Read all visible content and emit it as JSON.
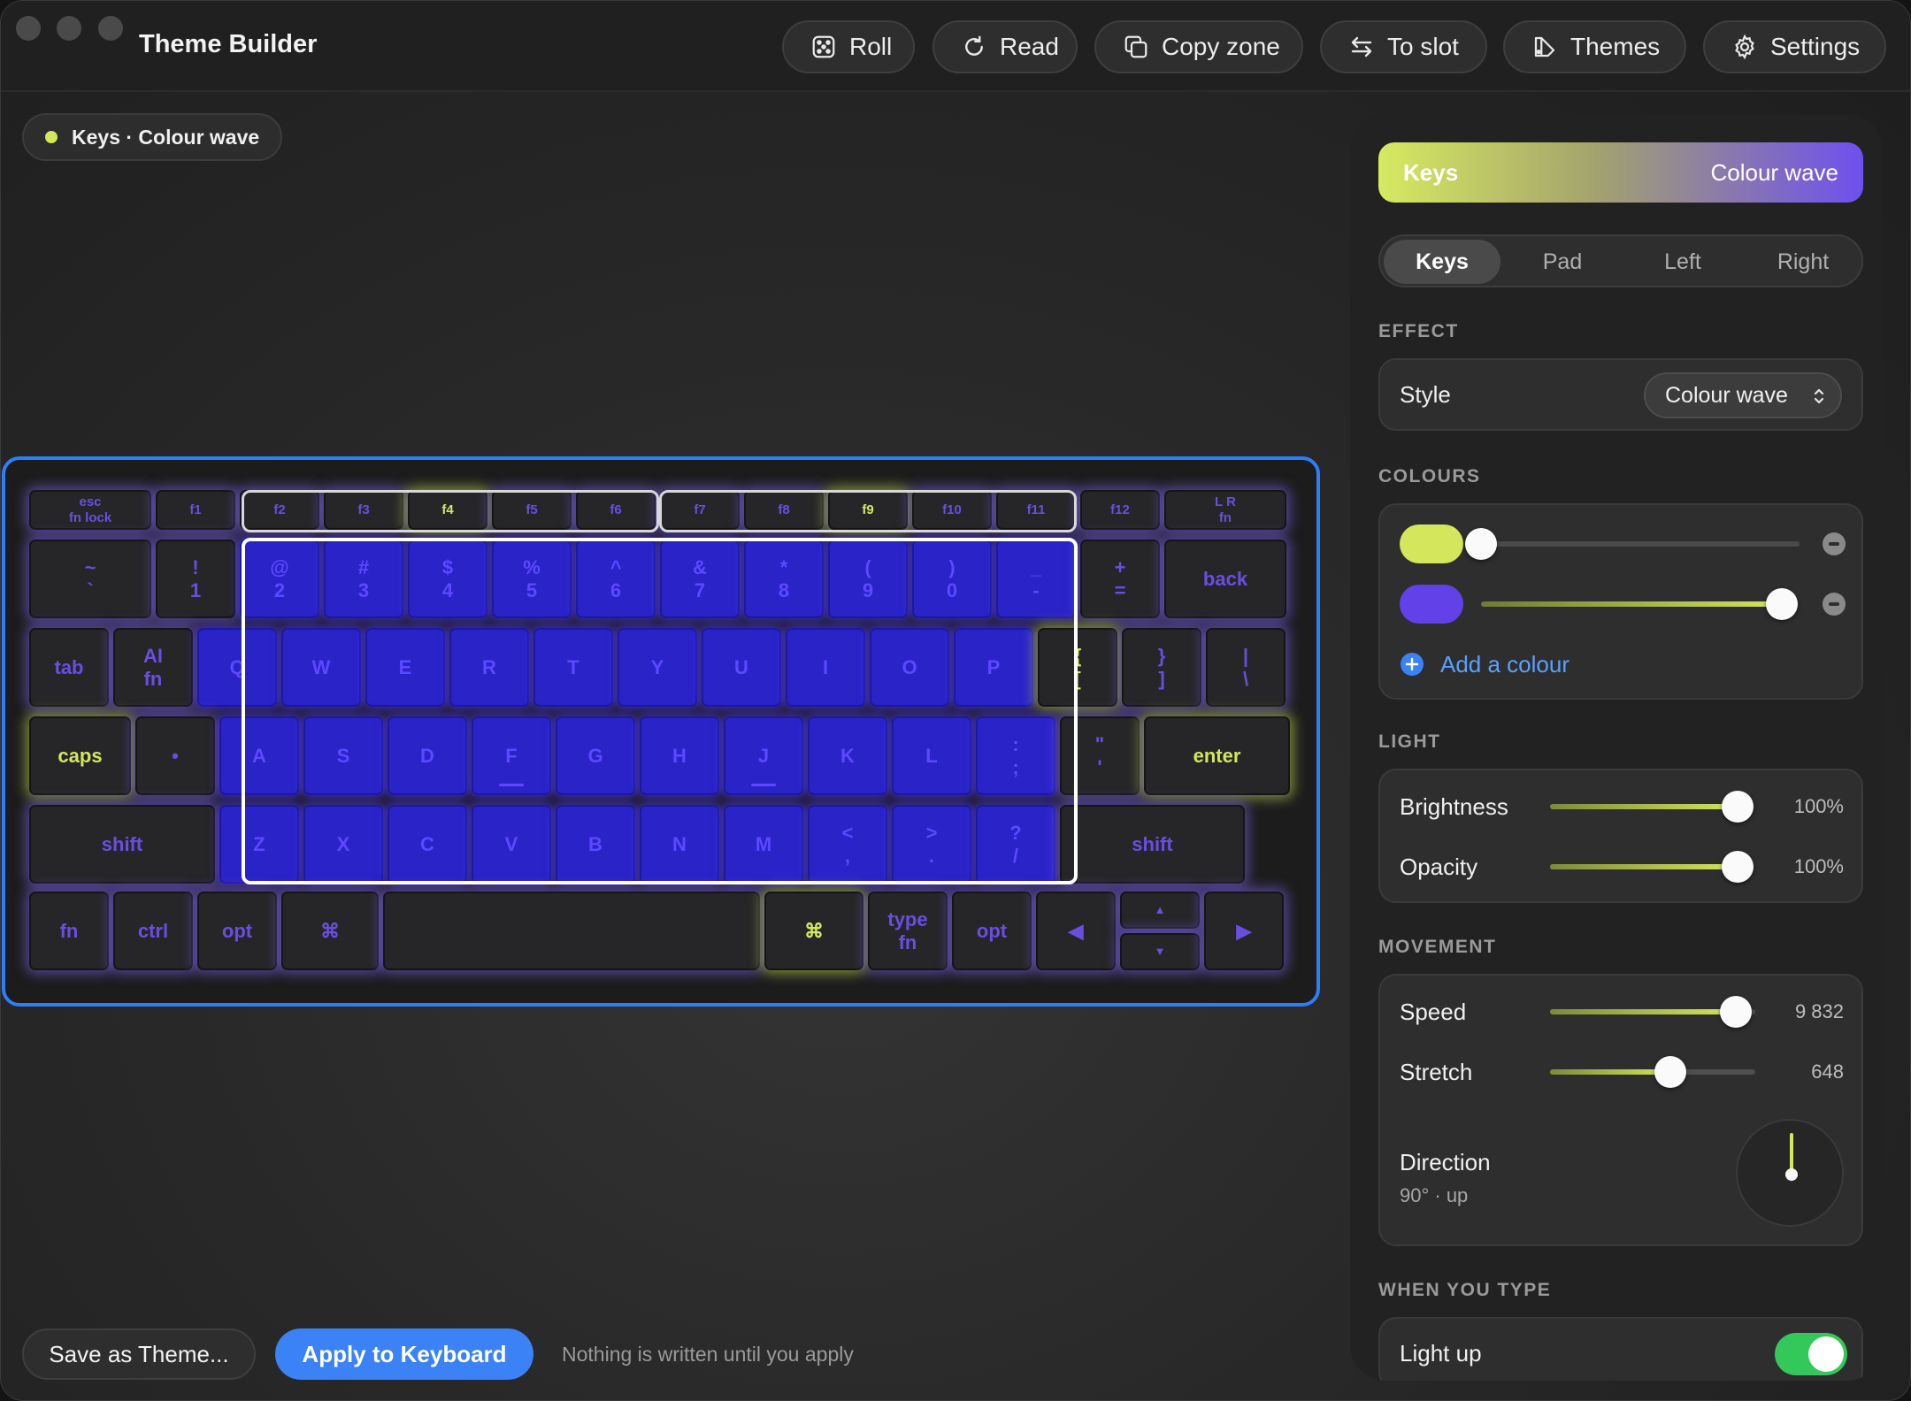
{
  "app": {
    "title": "Theme Builder"
  },
  "toolbar": {
    "roll": "Roll",
    "read": "Read",
    "copy_zone": "Copy zone",
    "to_slot": "To slot",
    "themes": "Themes",
    "settings": "Settings"
  },
  "zone_chip": {
    "label": "Keys · Colour wave"
  },
  "keyboard": {
    "rows": [
      [
        [
          "esc\nfn lock",
          "b"
        ],
        [
          "f1",
          "b"
        ],
        [
          "f2",
          "b"
        ],
        [
          "f3",
          "b"
        ],
        [
          "f4",
          "g"
        ],
        [
          "f5",
          "b"
        ],
        [
          "f6",
          "b"
        ],
        [
          "f7",
          "b"
        ],
        [
          "f8",
          "b"
        ],
        [
          "f9",
          "g"
        ],
        [
          "f10",
          "b"
        ],
        [
          "f11",
          "b"
        ],
        [
          "f12",
          "b"
        ],
        [
          "L R\nfn",
          "b"
        ]
      ],
      [
        [
          "~\n`",
          "b"
        ],
        [
          "!\n1",
          "b"
        ],
        [
          "@\n2",
          "l"
        ],
        [
          "#\n3",
          "l"
        ],
        [
          "$\n4",
          "l"
        ],
        [
          "%\n5",
          "l"
        ],
        [
          "^\n6",
          "l"
        ],
        [
          "&\n7",
          "l"
        ],
        [
          "*\n8",
          "l"
        ],
        [
          "(\n9",
          "l"
        ],
        [
          ")\n0",
          "l"
        ],
        [
          "_\n-",
          "l"
        ],
        [
          "+\n=",
          "b"
        ],
        [
          "back",
          "b"
        ]
      ],
      [
        [
          "tab",
          "b"
        ],
        [
          "AI\nfn",
          "b"
        ],
        [
          "Q",
          "l"
        ],
        [
          "W",
          "l"
        ],
        [
          "E",
          "l"
        ],
        [
          "R",
          "l"
        ],
        [
          "T",
          "l"
        ],
        [
          "Y",
          "l"
        ],
        [
          "U",
          "l"
        ],
        [
          "I",
          "l"
        ],
        [
          "O",
          "l"
        ],
        [
          "P",
          "l"
        ],
        [
          "{\n[",
          "g"
        ],
        [
          "}\n]",
          "b"
        ],
        [
          "|\n\\",
          "b"
        ]
      ],
      [
        [
          "caps",
          "g"
        ],
        [
          "•",
          "b"
        ],
        [
          "A",
          "l"
        ],
        [
          "S",
          "l"
        ],
        [
          "D",
          "l"
        ],
        [
          "F",
          "l"
        ],
        [
          "G",
          "l"
        ],
        [
          "H",
          "l"
        ],
        [
          "J",
          "l"
        ],
        [
          "K",
          "l"
        ],
        [
          "L",
          "l"
        ],
        [
          ":\n;",
          "l"
        ],
        [
          "\"\n'",
          "b"
        ],
        [
          "enter",
          "g"
        ]
      ],
      [
        [
          "shift",
          "b"
        ],
        [
          "Z",
          "l"
        ],
        [
          "X",
          "l"
        ],
        [
          "C",
          "l"
        ],
        [
          "V",
          "l"
        ],
        [
          "B",
          "l"
        ],
        [
          "N",
          "l"
        ],
        [
          "M",
          "l"
        ],
        [
          "<\n,",
          "l"
        ],
        [
          ">\n.",
          "l"
        ],
        [
          "?\n/",
          "l"
        ],
        [
          "shift",
          "b"
        ]
      ],
      [
        [
          "fn",
          "b"
        ],
        [
          "ctrl",
          "b"
        ],
        [
          "opt",
          "b"
        ],
        [
          "⌘",
          "b"
        ],
        [
          "",
          "b"
        ],
        [
          "⌘",
          "g"
        ],
        [
          "type\nfn",
          "b"
        ],
        [
          "opt",
          "b"
        ],
        [
          "◀",
          "b"
        ],
        [
          "▲",
          "b"
        ],
        [
          "▼",
          "b"
        ],
        [
          "▶",
          "b"
        ]
      ]
    ]
  },
  "bottom": {
    "save_theme": "Save as Theme...",
    "apply": "Apply to Keyboard",
    "note": "Nothing is written until you apply"
  },
  "panel": {
    "preview": {
      "left": "Keys",
      "right": "Colour wave",
      "gradient_start": "#d6ea60",
      "gradient_end": "#6e50ee"
    },
    "segments": [
      "Keys",
      "Pad",
      "Left",
      "Right"
    ],
    "segment_selected": "Keys",
    "effect": {
      "section": "EFFECT",
      "style_label": "Style",
      "style_value": "Colour wave"
    },
    "colours": {
      "section": "COLOURS",
      "items": [
        {
          "color": "#d3e65c",
          "position": 0.0
        },
        {
          "color": "#6341e8",
          "position": 1.0
        }
      ],
      "add_label": "Add a colour"
    },
    "light": {
      "section": "LIGHT",
      "brightness": {
        "label": "Brightness",
        "value": "100%",
        "fraction": 1.0
      },
      "opacity": {
        "label": "Opacity",
        "value": "100%",
        "fraction": 1.0
      }
    },
    "movement": {
      "section": "MOVEMENT",
      "speed": {
        "label": "Speed",
        "value": "9 832",
        "fraction": 0.98
      },
      "stretch": {
        "label": "Stretch",
        "value": "648",
        "fraction": 0.6
      },
      "direction": {
        "label": "Direction",
        "sub": "90° · up"
      }
    },
    "when_you_type": {
      "section": "WHEN YOU TYPE",
      "light_up": "Light up",
      "light_up_on": true
    }
  },
  "colors": {
    "accent": "#3a82f6",
    "lime": "#d3e65c",
    "violet": "#6341e8",
    "selection": "#2d7ef7"
  }
}
